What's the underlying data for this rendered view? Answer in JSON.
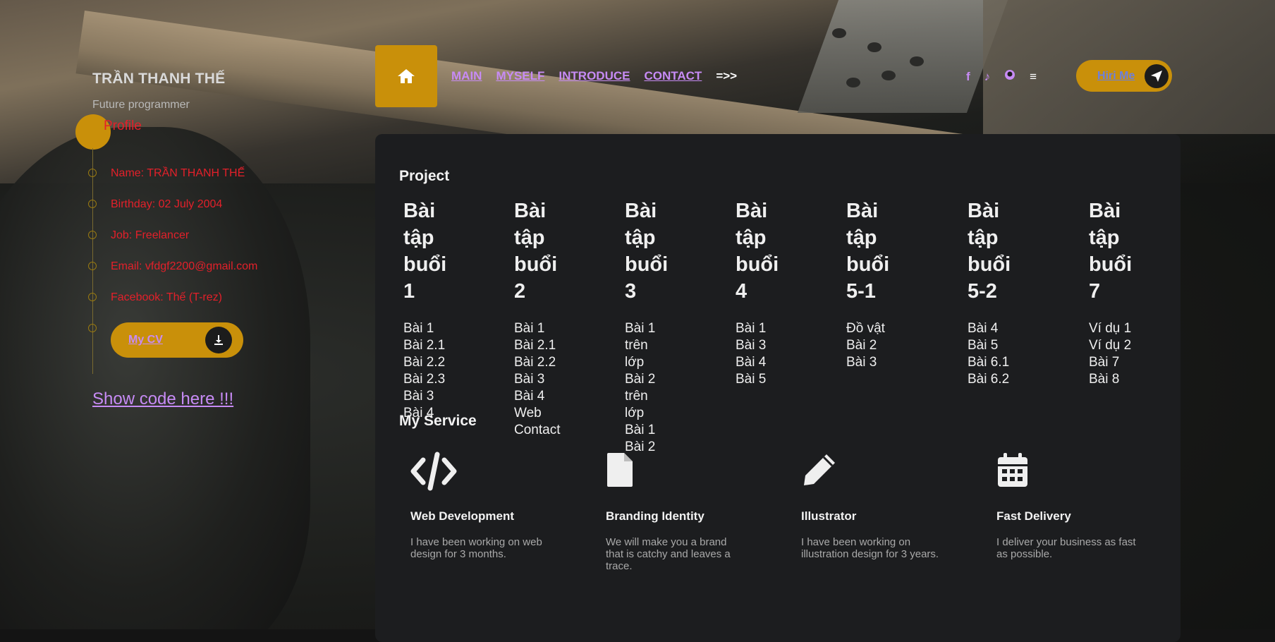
{
  "sidebar": {
    "name": "TRẦN THANH THẾ",
    "tagline": "Future programmer",
    "profile_label": "Profile",
    "info": [
      "Name: TRẦN THANH THẾ",
      "Birthday: 02 July 2004",
      "Job: Freelancer",
      "Email: vfdgf2200@gmail.com",
      "Facebook: Thế (T-rez)"
    ],
    "cv_label": "My CV",
    "show_code": "Show code here !!!"
  },
  "nav": {
    "items": [
      "MAIN",
      "MYSELF",
      "INTRODUCE",
      "CONTACT"
    ],
    "more": "=>>",
    "hire_label": "Hiri Me"
  },
  "social_icons": [
    "facebook-icon",
    "tiktok-icon",
    "github-icon",
    "menu-icon"
  ],
  "project": {
    "title": "Project",
    "columns": [
      {
        "heading": [
          "Bài tập",
          "buổi 1"
        ],
        "items": [
          "Bài 1",
          "Bài 2.1",
          "Bài 2.2",
          "Bài 2.3",
          "Bài 3",
          "Bài 4"
        ]
      },
      {
        "heading": [
          "Bài tập",
          "buổi 2"
        ],
        "items": [
          "Bài 1",
          "Bài 2.1",
          "Bài 2.2",
          "Bài 3",
          "Bài 4",
          "Web",
          "Contact"
        ]
      },
      {
        "heading": [
          "Bài tập",
          "buổi 3"
        ],
        "items": [
          "Bài 1 trên",
          "lớp",
          "Bài 2 trên",
          "lớp",
          "Bài 1",
          "Bài 2"
        ]
      },
      {
        "heading": [
          "Bài tập",
          "buổi 4"
        ],
        "items": [
          "Bài 1",
          "Bài 3",
          "Bài 4",
          "Bài 5"
        ]
      },
      {
        "heading": [
          "Bài tập",
          "buổi 5-1"
        ],
        "items": [
          "Đồ vật",
          "Bài 2",
          "Bài 3"
        ]
      },
      {
        "heading": [
          "Bài tập",
          "buổi 5-2"
        ],
        "items": [
          "Bài 4",
          "Bài 5",
          "Bài 6.1",
          "Bài 6.2"
        ]
      },
      {
        "heading": [
          "Bài tập",
          "buổi 7"
        ],
        "items": [
          "Ví dụ 1",
          "Ví dụ 2",
          "Bài 7",
          "Bài 8"
        ]
      }
    ]
  },
  "services": {
    "title": "My Service",
    "items": [
      {
        "icon": "code-icon",
        "title": "Web Development",
        "desc": "I have been working on web design for 3 months."
      },
      {
        "icon": "file-icon",
        "title": "Branding Identity",
        "desc": "We will make you a brand that is catchy and leaves a trace."
      },
      {
        "icon": "pencil-icon",
        "title": "Illustrator",
        "desc": "I have been working on illustration design for 3 years."
      },
      {
        "icon": "calendar-icon",
        "title": "Fast Delivery",
        "desc": "I deliver your business as fast as possible."
      }
    ]
  },
  "colors": {
    "accent": "#c9900a",
    "link": "#c78bf5",
    "info_text": "#e3202a",
    "panel": "#1c1d1f"
  }
}
